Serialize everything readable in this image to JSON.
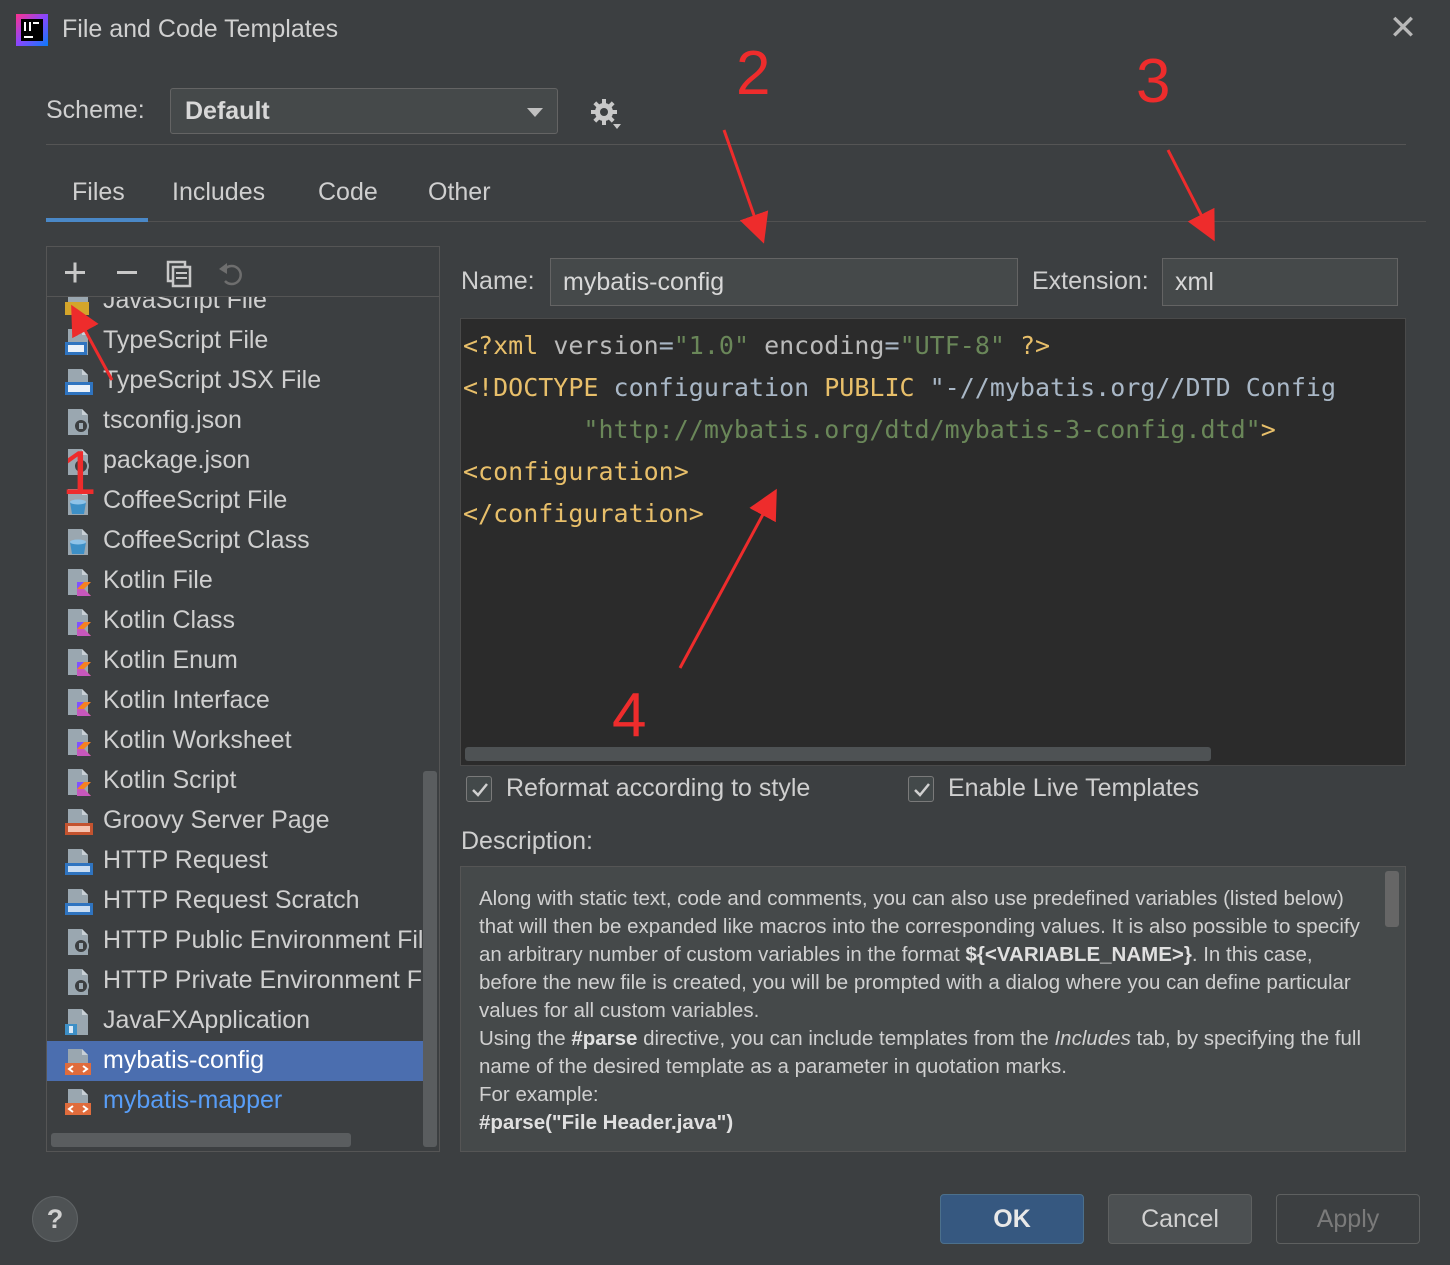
{
  "window": {
    "title": "File and Code Templates",
    "close_glyph": "✕"
  },
  "scheme": {
    "label": "Scheme:",
    "value": "Default"
  },
  "tabs": [
    {
      "label": "Files",
      "active": true
    },
    {
      "label": "Includes",
      "active": false
    },
    {
      "label": "Code",
      "active": false
    },
    {
      "label": "Other",
      "active": false
    }
  ],
  "toolbar": {
    "add": "add-icon",
    "remove": "remove-icon",
    "copy": "copy-icon",
    "reset": "reset-icon"
  },
  "template_list": [
    {
      "label": "JavaScript File",
      "icon": "javascript-file-icon"
    },
    {
      "label": "TypeScript File",
      "icon": "typescript-file-icon"
    },
    {
      "label": "TypeScript JSX File",
      "icon": "tsx-file-icon"
    },
    {
      "label": "tsconfig.json",
      "icon": "json-file-icon"
    },
    {
      "label": "package.json",
      "icon": "json-file-icon"
    },
    {
      "label": "CoffeeScript File",
      "icon": "coffeescript-icon"
    },
    {
      "label": "CoffeeScript Class",
      "icon": "coffeescript-icon"
    },
    {
      "label": "Kotlin File",
      "icon": "kotlin-icon"
    },
    {
      "label": "Kotlin Class",
      "icon": "kotlin-icon"
    },
    {
      "label": "Kotlin Enum",
      "icon": "kotlin-icon"
    },
    {
      "label": "Kotlin Interface",
      "icon": "kotlin-icon"
    },
    {
      "label": "Kotlin Worksheet",
      "icon": "kotlin-icon"
    },
    {
      "label": "Kotlin Script",
      "icon": "kotlin-icon"
    },
    {
      "label": "Groovy Server Page",
      "icon": "gsp-icon"
    },
    {
      "label": "HTTP Request",
      "icon": "api-icon"
    },
    {
      "label": "HTTP Request Scratch",
      "icon": "api-icon"
    },
    {
      "label": "HTTP Public Environment File",
      "icon": "json-file-icon"
    },
    {
      "label": "HTTP Private Environment File",
      "icon": "json-file-icon"
    },
    {
      "label": "JavaFXApplication",
      "icon": "java-file-icon"
    },
    {
      "label": "mybatis-config",
      "icon": "xml-file-icon",
      "selected": true
    },
    {
      "label": "mybatis-mapper",
      "icon": "xml-file-icon",
      "modified": true
    }
  ],
  "form": {
    "name_label": "Name:",
    "name_value": "mybatis-config",
    "extension_label": "Extension:",
    "extension_value": "xml"
  },
  "editor": {
    "lines": [
      "<?xml version=\"1.0\" encoding=\"UTF-8\" ?>",
      "<!DOCTYPE configuration PUBLIC \"-//mybatis.org//DTD Config",
      "        \"http://mybatis.org/dtd/mybatis-3-config.dtd\">",
      "<configuration>",
      "</configuration>"
    ]
  },
  "options": {
    "reformat_label": "Reformat according to style",
    "reformat_checked": true,
    "live_templates_label": "Enable Live Templates",
    "live_templates_checked": true
  },
  "description": {
    "label": "Description:",
    "p1_a": "Along with static text, code and comments, you can also use predefined variables (listed below) that will then be expanded like macros into the corresponding values. It is also possible to specify an arbitrary number of custom variables in the format ",
    "p1_b": "${<VARIABLE_NAME>}",
    "p1_c": ". In this case, before the new file is created, you will be prompted with a dialog where you can define particular values for all custom variables.",
    "p2_a": "Using the ",
    "p2_b": "#parse",
    "p2_c": " directive, you can include templates from the ",
    "p2_d": "Includes",
    "p2_e": " tab, by specifying the full name of the desired template as a parameter in quotation marks.",
    "p3": "For example:",
    "p4": "#parse(\"File Header.java\")"
  },
  "buttons": {
    "help": "?",
    "ok": "OK",
    "cancel": "Cancel",
    "apply": "Apply"
  },
  "annotations": {
    "n1": "1",
    "n2": "2",
    "n3": "3",
    "n4": "4",
    "color": "#ee2c2c"
  }
}
